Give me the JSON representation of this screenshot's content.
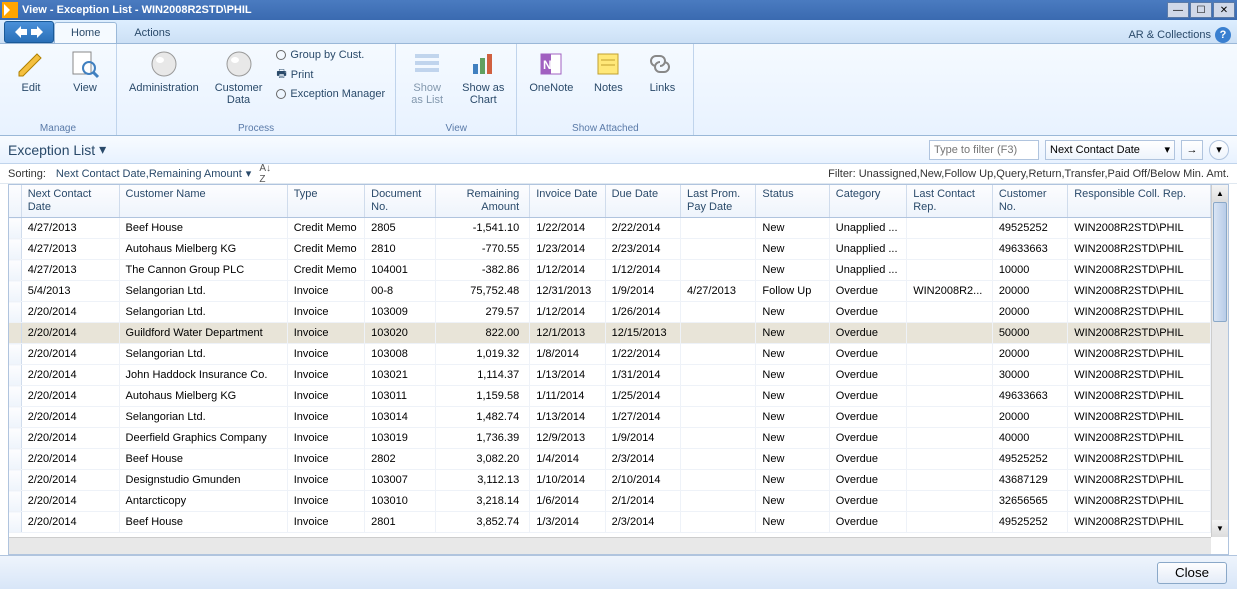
{
  "window": {
    "title": "View - Exception List - WIN2008R2STD\\PHIL",
    "right_label": "AR & Collections"
  },
  "tabs": {
    "home": "Home",
    "actions": "Actions"
  },
  "ribbon": {
    "manage": {
      "label": "Manage",
      "edit": "Edit",
      "view": "View"
    },
    "process": {
      "label": "Process",
      "admin": "Administration",
      "customer": "Customer\nData",
      "group": "Group by Cust.",
      "print": "Print",
      "exmgr": "Exception Manager"
    },
    "view": {
      "label": "View",
      "list": "Show\nas List",
      "chart": "Show as\nChart"
    },
    "attached": {
      "label": "Show Attached",
      "onenote": "OneNote",
      "notes": "Notes",
      "links": "Links"
    }
  },
  "pathbar": {
    "breadcrumb": "Exception List",
    "filter_placeholder": "Type to filter (F3)",
    "sort_field": "Next Contact Date"
  },
  "info": {
    "sorting_label": "Sorting:",
    "sorting_value": "Next Contact Date,Remaining Amount",
    "filter_text": "Filter: Unassigned,New,Follow Up,Query,Return,Transfer,Paid Off/Below Min. Amt."
  },
  "columns": {
    "ncd": "Next Contact\nDate",
    "cust": "Customer Name",
    "type": "Type",
    "doc": "Document\nNo.",
    "rem": "Remaining\nAmount",
    "inv": "Invoice Date",
    "due": "Due Date",
    "lpp": "Last Prom.\nPay Date",
    "status": "Status",
    "cat": "Category",
    "lcr": "Last Contact\nRep.",
    "cno": "Customer\nNo.",
    "rcr": "Responsible Coll. Rep."
  },
  "rows": [
    {
      "ncd": "4/27/2013",
      "cust": "Beef House",
      "type": "Credit Memo",
      "doc": "2805",
      "rem": "-1,541.10",
      "inv": "1/22/2014",
      "due": "2/22/2014",
      "lpp": "",
      "status": "New",
      "cat": "Unapplied ...",
      "lcr": "",
      "cno": "49525252",
      "rcr": "WIN2008R2STD\\PHIL"
    },
    {
      "ncd": "4/27/2013",
      "cust": "Autohaus Mielberg KG",
      "type": "Credit Memo",
      "doc": "2810",
      "rem": "-770.55",
      "inv": "1/23/2014",
      "due": "2/23/2014",
      "lpp": "",
      "status": "New",
      "cat": "Unapplied ...",
      "lcr": "",
      "cno": "49633663",
      "rcr": "WIN2008R2STD\\PHIL"
    },
    {
      "ncd": "4/27/2013",
      "cust": "The Cannon Group PLC",
      "type": "Credit Memo",
      "doc": "104001",
      "rem": "-382.86",
      "inv": "1/12/2014",
      "due": "1/12/2014",
      "lpp": "",
      "status": "New",
      "cat": "Unapplied ...",
      "lcr": "",
      "cno": "10000",
      "rcr": "WIN2008R2STD\\PHIL"
    },
    {
      "ncd": "5/4/2013",
      "cust": "Selangorian Ltd.",
      "type": "Invoice",
      "doc": "00-8",
      "rem": "75,752.48",
      "inv": "12/31/2013",
      "due": "1/9/2014",
      "lpp": "4/27/2013",
      "status": "Follow Up",
      "cat": "Overdue",
      "lcr": "WIN2008R2...",
      "cno": "20000",
      "rcr": "WIN2008R2STD\\PHIL"
    },
    {
      "ncd": "2/20/2014",
      "cust": "Selangorian Ltd.",
      "type": "Invoice",
      "doc": "103009",
      "rem": "279.57",
      "inv": "1/12/2014",
      "due": "1/26/2014",
      "lpp": "",
      "status": "New",
      "cat": "Overdue",
      "lcr": "",
      "cno": "20000",
      "rcr": "WIN2008R2STD\\PHIL"
    },
    {
      "ncd": "2/20/2014",
      "cust": "Guildford Water Department",
      "type": "Invoice",
      "doc": "103020",
      "rem": "822.00",
      "inv": "12/1/2013",
      "due": "12/15/2013",
      "lpp": "",
      "status": "New",
      "cat": "Overdue",
      "lcr": "",
      "cno": "50000",
      "rcr": "WIN2008R2STD\\PHIL",
      "selected": true
    },
    {
      "ncd": "2/20/2014",
      "cust": "Selangorian Ltd.",
      "type": "Invoice",
      "doc": "103008",
      "rem": "1,019.32",
      "inv": "1/8/2014",
      "due": "1/22/2014",
      "lpp": "",
      "status": "New",
      "cat": "Overdue",
      "lcr": "",
      "cno": "20000",
      "rcr": "WIN2008R2STD\\PHIL"
    },
    {
      "ncd": "2/20/2014",
      "cust": "John Haddock Insurance Co.",
      "type": "Invoice",
      "doc": "103021",
      "rem": "1,114.37",
      "inv": "1/13/2014",
      "due": "1/31/2014",
      "lpp": "",
      "status": "New",
      "cat": "Overdue",
      "lcr": "",
      "cno": "30000",
      "rcr": "WIN2008R2STD\\PHIL"
    },
    {
      "ncd": "2/20/2014",
      "cust": "Autohaus Mielberg KG",
      "type": "Invoice",
      "doc": "103011",
      "rem": "1,159.58",
      "inv": "1/11/2014",
      "due": "1/25/2014",
      "lpp": "",
      "status": "New",
      "cat": "Overdue",
      "lcr": "",
      "cno": "49633663",
      "rcr": "WIN2008R2STD\\PHIL"
    },
    {
      "ncd": "2/20/2014",
      "cust": "Selangorian Ltd.",
      "type": "Invoice",
      "doc": "103014",
      "rem": "1,482.74",
      "inv": "1/13/2014",
      "due": "1/27/2014",
      "lpp": "",
      "status": "New",
      "cat": "Overdue",
      "lcr": "",
      "cno": "20000",
      "rcr": "WIN2008R2STD\\PHIL"
    },
    {
      "ncd": "2/20/2014",
      "cust": "Deerfield Graphics Company",
      "type": "Invoice",
      "doc": "103019",
      "rem": "1,736.39",
      "inv": "12/9/2013",
      "due": "1/9/2014",
      "lpp": "",
      "status": "New",
      "cat": "Overdue",
      "lcr": "",
      "cno": "40000",
      "rcr": "WIN2008R2STD\\PHIL"
    },
    {
      "ncd": "2/20/2014",
      "cust": "Beef House",
      "type": "Invoice",
      "doc": "2802",
      "rem": "3,082.20",
      "inv": "1/4/2014",
      "due": "2/3/2014",
      "lpp": "",
      "status": "New",
      "cat": "Overdue",
      "lcr": "",
      "cno": "49525252",
      "rcr": "WIN2008R2STD\\PHIL"
    },
    {
      "ncd": "2/20/2014",
      "cust": "Designstudio Gmunden",
      "type": "Invoice",
      "doc": "103007",
      "rem": "3,112.13",
      "inv": "1/10/2014",
      "due": "2/10/2014",
      "lpp": "",
      "status": "New",
      "cat": "Overdue",
      "lcr": "",
      "cno": "43687129",
      "rcr": "WIN2008R2STD\\PHIL"
    },
    {
      "ncd": "2/20/2014",
      "cust": "Antarcticopy",
      "type": "Invoice",
      "doc": "103010",
      "rem": "3,218.14",
      "inv": "1/6/2014",
      "due": "2/1/2014",
      "lpp": "",
      "status": "New",
      "cat": "Overdue",
      "lcr": "",
      "cno": "32656565",
      "rcr": "WIN2008R2STD\\PHIL"
    },
    {
      "ncd": "2/20/2014",
      "cust": "Beef House",
      "type": "Invoice",
      "doc": "2801",
      "rem": "3,852.74",
      "inv": "1/3/2014",
      "due": "2/3/2014",
      "lpp": "",
      "status": "New",
      "cat": "Overdue",
      "lcr": "",
      "cno": "49525252",
      "rcr": "WIN2008R2STD\\PHIL"
    }
  ],
  "footer": {
    "close": "Close"
  }
}
